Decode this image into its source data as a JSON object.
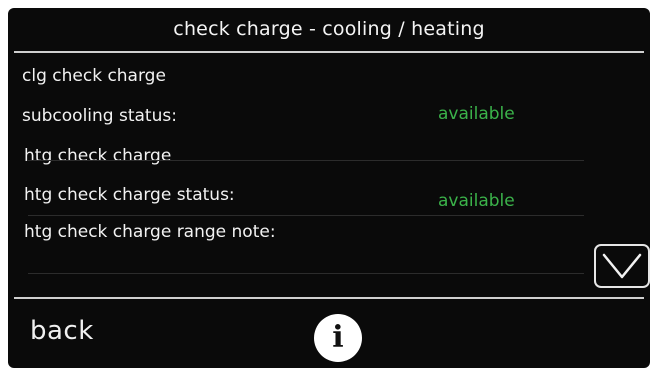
{
  "header": {
    "title": "check charge - cooling / heating"
  },
  "rows": [
    {
      "label": "clg check charge",
      "value": ""
    },
    {
      "label": "subcooling status:",
      "value": "available"
    },
    {
      "label": "htg check charge",
      "value": ""
    },
    {
      "label": "htg check charge status:",
      "value": "available"
    },
    {
      "label": "htg check charge range note:",
      "value": ""
    }
  ],
  "controls": {
    "scroll_icon": "chevron-down-icon",
    "back_label": "back",
    "info_icon": "info-icon",
    "info_glyph": "i"
  },
  "colors": {
    "background": "#0a0a0a",
    "text": "#f2f2f2",
    "status_available": "#3bb34a"
  }
}
